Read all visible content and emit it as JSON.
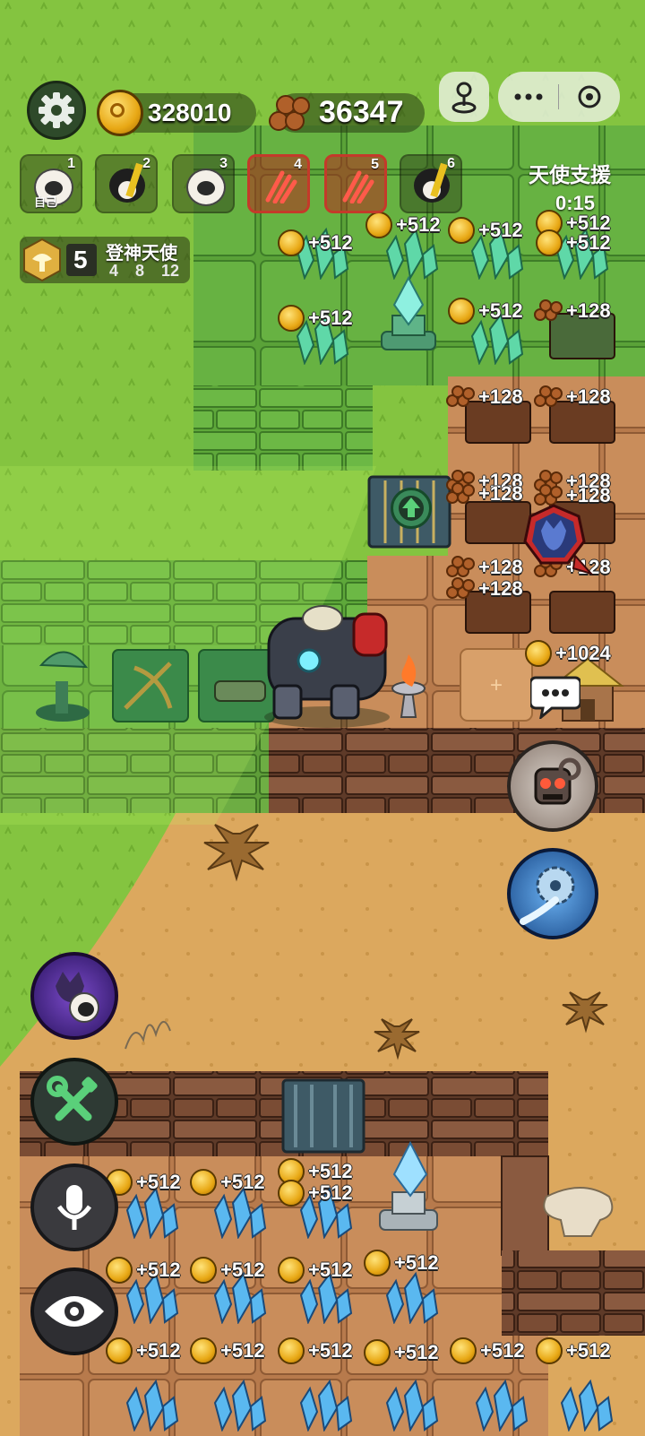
{
  "hud": {
    "gold": "328010",
    "wood": "36347",
    "angel_support_label": "天使支援",
    "angel_timer": "0:15"
  },
  "players": [
    {
      "index": "1",
      "tag": "自己",
      "style": "sheep-witch"
    },
    {
      "index": "2",
      "tag": "",
      "style": "penguin-pole"
    },
    {
      "index": "3",
      "tag": "",
      "style": "sheep-ninja"
    },
    {
      "index": "4",
      "tag": "",
      "style": "claw-red"
    },
    {
      "index": "5",
      "tag": "",
      "style": "claw-red"
    },
    {
      "index": "6",
      "tag": "",
      "style": "penguin-pole"
    }
  ],
  "rank": {
    "level": "5",
    "title": "登神天使",
    "milestones": [
      "4",
      "8",
      "12"
    ]
  },
  "floats": {
    "gold_small": "+512",
    "wood_small": "+128",
    "gold_big": "+1024"
  },
  "icons": {
    "settings": "gear-icon",
    "joystick": "joystick-icon",
    "more": "more-icon",
    "record": "target-icon",
    "chat": "chat-bubble-icon",
    "robot_skill": "robot-skull-icon",
    "saw_skill": "saw-blade-icon",
    "wolf_sheep": "wolf-sheep-icon",
    "tools": "tools-icon",
    "mic": "microphone-icon",
    "eye": "eye-icon",
    "upgrade": "arrow-up-icon"
  },
  "colors": {
    "grass": "#7cbf3c",
    "dirt": "#d9a45a",
    "gold": "#e8a815",
    "danger": "#c43a2a"
  }
}
